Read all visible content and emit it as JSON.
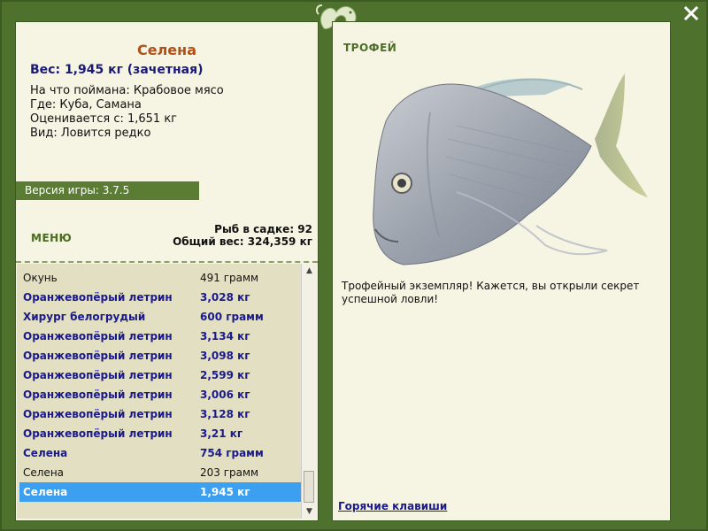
{
  "window": {
    "close_label": "X"
  },
  "fish": {
    "name": "Селена",
    "weight_line": "Вес: 1,945 кг (зачетная)",
    "bait": "На что поймана: Крабовое мясо",
    "location": "Где: Куба, Самана",
    "valued_from": "Оценивается с: 1,651 кг",
    "kind": "Вид: Ловится редко"
  },
  "version": "Версия игры: 3.7.5",
  "menu_label": "МЕНЮ",
  "stats": {
    "fish_in_cage": "Рыб в садке: 92",
    "total_weight": "Общий вес: 324,359 кг"
  },
  "catch_list": [
    {
      "name": "Окунь",
      "weight": "491 грамм",
      "style": "plain"
    },
    {
      "name": "Оранжевопёрый летрин",
      "weight": "3,028 кг",
      "style": "bold"
    },
    {
      "name": "Хирург белогрудый",
      "weight": "600 грамм",
      "style": "bold"
    },
    {
      "name": "Оранжевопёрый летрин",
      "weight": "3,134 кг",
      "style": "bold"
    },
    {
      "name": "Оранжевопёрый летрин",
      "weight": "3,098 кг",
      "style": "bold"
    },
    {
      "name": "Оранжевопёрый летрин",
      "weight": "2,599 кг",
      "style": "bold"
    },
    {
      "name": "Оранжевопёрый летрин",
      "weight": "3,006 кг",
      "style": "bold"
    },
    {
      "name": "Оранжевопёрый летрин",
      "weight": "3,128 кг",
      "style": "bold"
    },
    {
      "name": "Оранжевопёрый летрин",
      "weight": "3,21 кг",
      "style": "bold"
    },
    {
      "name": "Селена",
      "weight": "754 грамм",
      "style": "bold"
    },
    {
      "name": "Селена",
      "weight": "203 грамм",
      "style": "plain"
    },
    {
      "name": "Селена",
      "weight": "1,945 кг",
      "style": "sel"
    }
  ],
  "trophy": {
    "title": "ТРОФЕЙ",
    "text": "Трофейный экземпляр! Кажется, вы открыли секрет успешной ловли!",
    "hotkeys": "Горячие клавиши"
  },
  "icons": [
    "close-icon",
    "logo-icon",
    "scroll-up-icon",
    "scroll-down-icon",
    "fish-image"
  ],
  "colors": {
    "frame": "#4e722e",
    "panel": "#f6f4e2",
    "name": "#b0501a",
    "bold_text": "#1a1a8a",
    "selected": "#3d9ff0"
  }
}
